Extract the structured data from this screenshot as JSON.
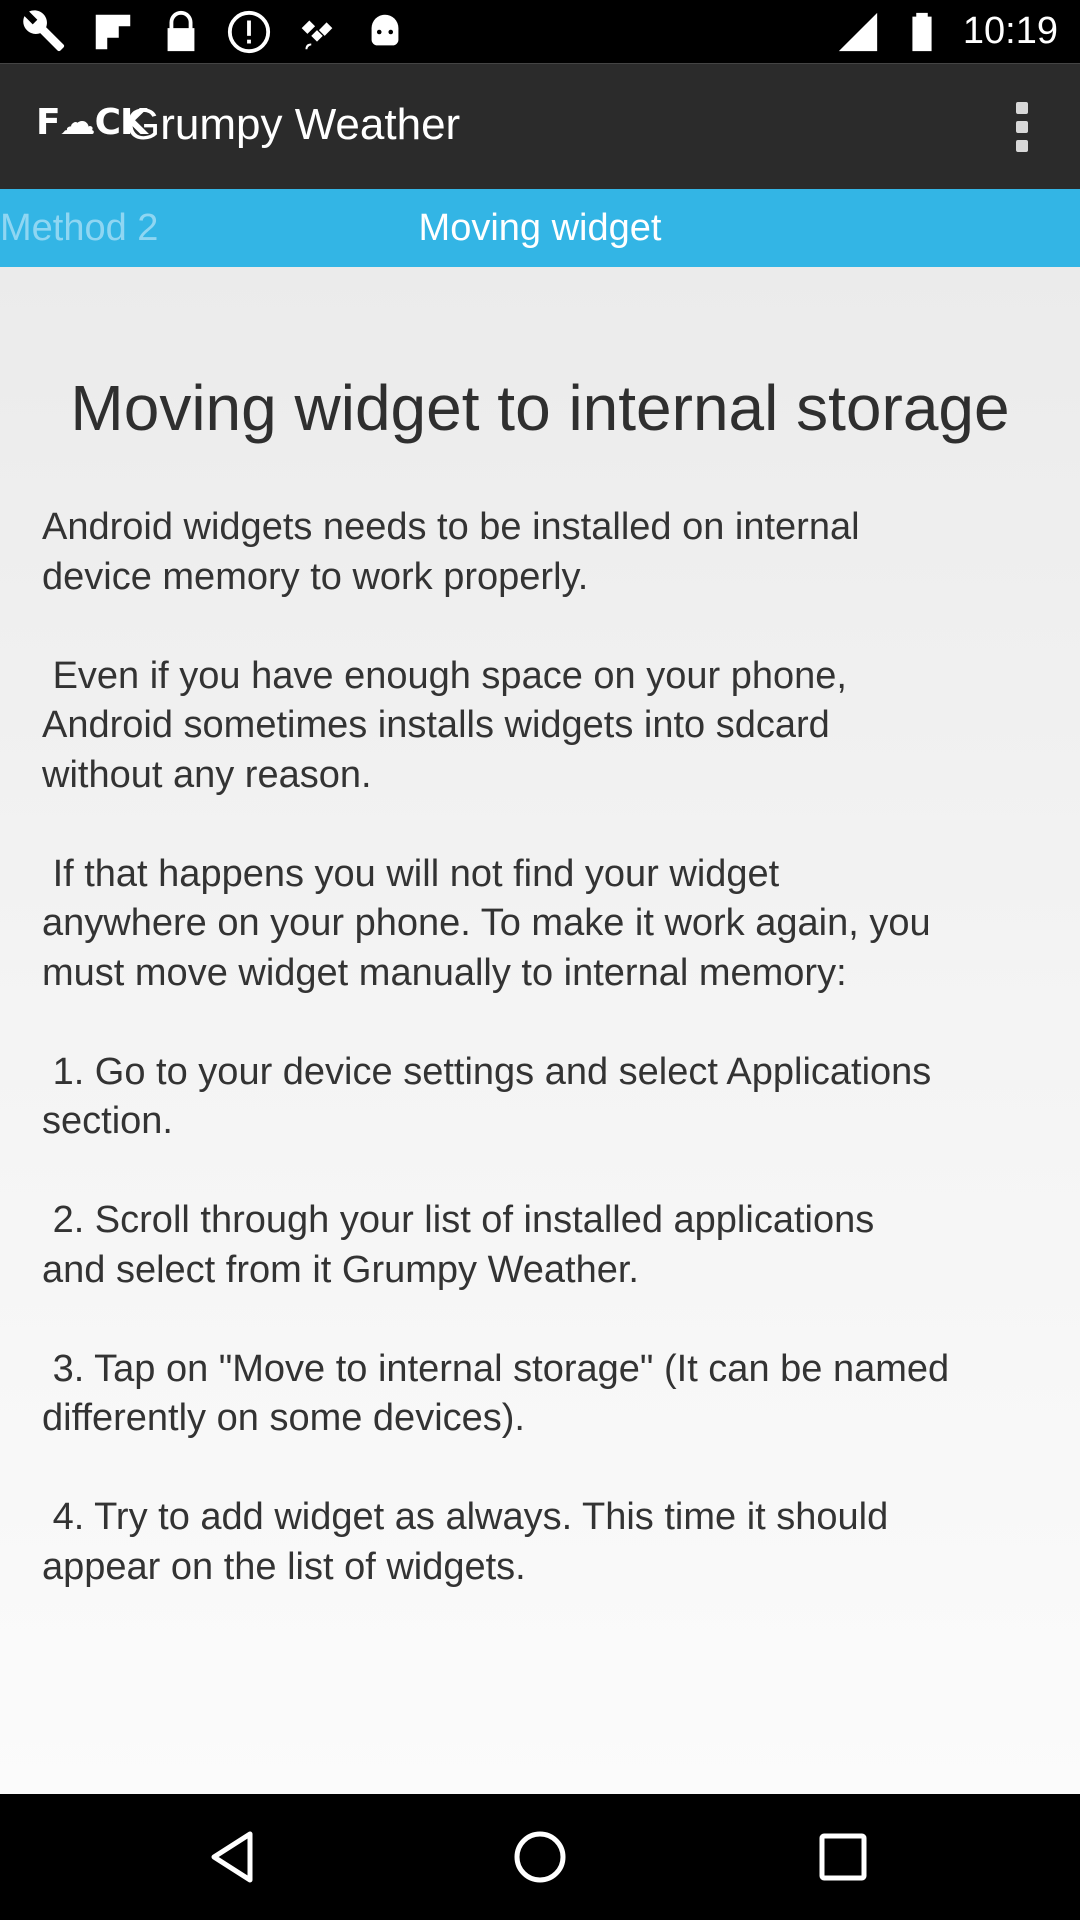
{
  "status_bar": {
    "time": "10:19",
    "left_icons": [
      "wrench-icon",
      "flipboard-icon",
      "lock-icon",
      "alert-icon",
      "fake-gps-icon",
      "android-icon"
    ],
    "right_icons": [
      "signal-icon",
      "battery-icon"
    ]
  },
  "app_bar": {
    "logo_text": "F☁CK",
    "title": "Grumpy Weather"
  },
  "tabs": {
    "previous": "Method 2",
    "current": "Moving widget"
  },
  "article": {
    "heading": "Moving widget to internal storage",
    "body": "Android widgets needs to be installed on internal\ndevice memory to work properly.\n\n Even if you have enough space on your phone,\nAndroid sometimes installs widgets into sdcard\nwithout any reason.\n\n If that happens you will not find your widget\nanywhere on your phone. To make it work again, you\nmust move widget manually to internal memory:\n\n 1. Go to your device settings and select Applications\nsection.\n\n 2. Scroll through your list of installed applications\nand select from it Grumpy Weather.\n\n 3. Tap on \"Move to internal storage\" (It can be named\ndifferently on some devices).\n\n 4. Try to add widget as always. This time it should\nappear on the list of widgets."
  },
  "nav_bar": {
    "buttons": [
      "back-icon",
      "home-icon",
      "recent-apps-icon"
    ]
  },
  "colors": {
    "tab_strip": "#33b5e5",
    "app_bar": "#2b2b2b"
  }
}
